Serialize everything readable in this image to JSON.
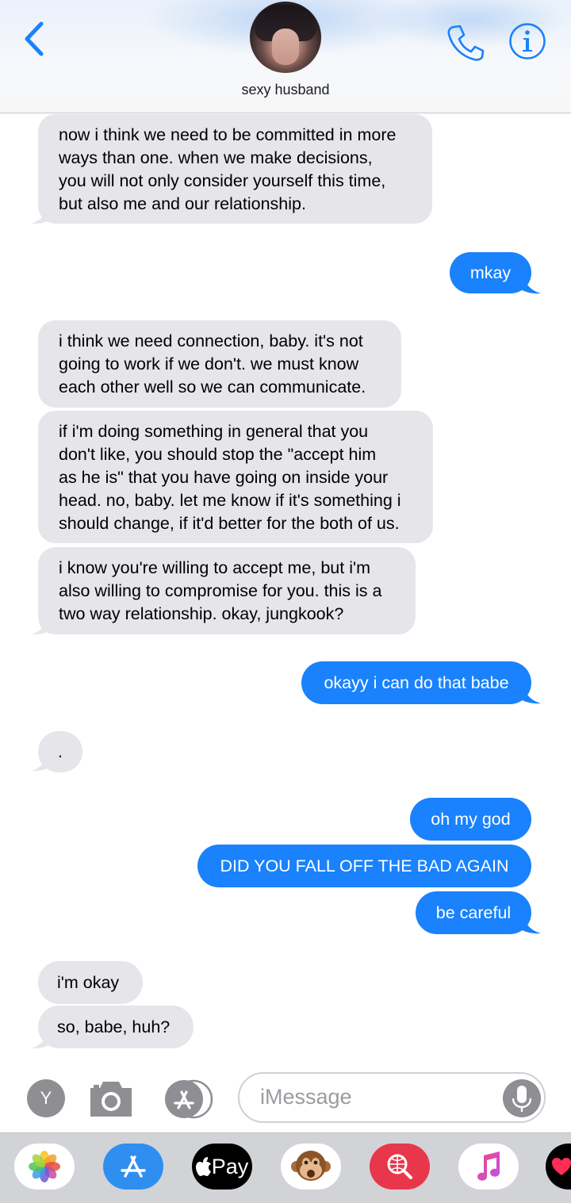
{
  "header": {
    "contact_name": "sexy husband",
    "back_icon": "chevron-left-icon",
    "call_icon": "phone-icon",
    "info_icon": "info-icon",
    "accent_color": "#1982fc"
  },
  "messages": [
    {
      "from": "them",
      "text": "now i think we need to be committed in more\nways than one. when we make decisions,\nyou will not only consider yourself this time,\nbut also me and our relationship."
    },
    {
      "from": "me",
      "text": "mkay"
    },
    {
      "from": "them",
      "text": "i think we need connection, baby. it's not\ngoing to work if we don't. we must know\neach other well so we can communicate."
    },
    {
      "from": "them",
      "text": "if i'm doing something in general that you\ndon't like, you should stop the \"accept him\nas he is\" that you have going on inside your\nhead. no, baby. let me know if it's something i\nshould change, if it'd better for the both of us."
    },
    {
      "from": "them",
      "text": "i know you're willing to accept me, but i'm\nalso willing to compromise for you. this is a\ntwo way relationship. okay, jungkook?"
    },
    {
      "from": "me",
      "text": "okayy i can do that babe"
    },
    {
      "from": "them",
      "text": "."
    },
    {
      "from": "me",
      "text": "oh my god"
    },
    {
      "from": "me",
      "text": "DID YOU FALL OFF THE BAD AGAIN"
    },
    {
      "from": "me",
      "text": "be careful"
    },
    {
      "from": "them",
      "text": "i'm okay"
    },
    {
      "from": "them",
      "text": "so, babe, huh?"
    }
  ],
  "input_bar": {
    "avatar_letter": "Y",
    "placeholder": "iMessage",
    "camera_icon": "camera-icon",
    "apps_icon": "app-store-icon",
    "mic_icon": "microphone-icon"
  },
  "app_strip": {
    "apple_pay_label": "Pay",
    "apps": [
      "photos-icon",
      "app-store-icon",
      "apple-pay-icon",
      "animoji-monkey-icon",
      "web-search-icon",
      "music-icon",
      "digital-touch-icon"
    ]
  }
}
